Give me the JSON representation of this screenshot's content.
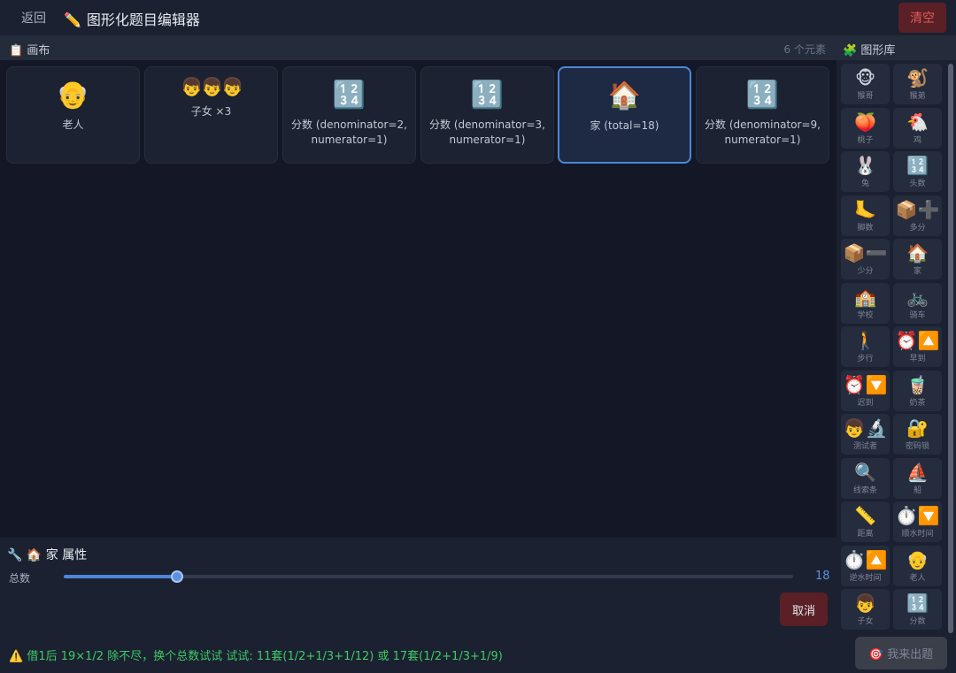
{
  "topbar": {
    "back_label": "返回",
    "title_icon": "✏️",
    "title": "图形化题目编辑器",
    "clear_label": "清空"
  },
  "canvas": {
    "icon": "📋",
    "title": "画布",
    "count_label": "6 个元素"
  },
  "cards": [
    {
      "icon": "👴",
      "label": "老人"
    },
    {
      "icon": "👦👦👦",
      "label": "子女 ×3"
    },
    {
      "icon": "🔢",
      "label": "分数 (denominator=2, numerator=1)"
    },
    {
      "icon": "🔢",
      "label": "分数 (denominator=3, numerator=1)"
    },
    {
      "icon": "🏠",
      "label": "家 (total=18)"
    },
    {
      "icon": "🔢",
      "label": "分数 (denominator=9, numerator=1)"
    }
  ],
  "properties": {
    "title_icon": "🔧",
    "element_icon": "🏠",
    "title": "家 属性",
    "field_label": "总数",
    "value": "18",
    "slider_fraction": 0.155,
    "cancel_label": "取消"
  },
  "status": {
    "text": "⚠️ 借1后 19×1/2 除不尽，换个总数试试 试试: 11套(1/2+1/3+1/12) 或 17套(1/2+1/3+1/9)"
  },
  "submit": {
    "label": "🎯 我来出题"
  },
  "library": {
    "icon": "🧩",
    "title": "图形库",
    "items": [
      {
        "icon": "🐵",
        "label": "猴哥"
      },
      {
        "icon": "🐒",
        "label": "猴弟"
      },
      {
        "icon": "🍑",
        "label": "桃子"
      },
      {
        "icon": "🐔",
        "label": "鸡"
      },
      {
        "icon": "🐰",
        "label": "兔"
      },
      {
        "icon": "🔢",
        "label": "头数"
      },
      {
        "icon": "🦶",
        "label": "脚数"
      },
      {
        "icon": "📦➕",
        "label": "多分"
      },
      {
        "icon": "📦➖",
        "label": "少分"
      },
      {
        "icon": "🏠",
        "label": "家"
      },
      {
        "icon": "🏫",
        "label": "学校"
      },
      {
        "icon": "🚲",
        "label": "骑车"
      },
      {
        "icon": "🚶",
        "label": "步行"
      },
      {
        "icon": "⏰🔼",
        "label": "早到"
      },
      {
        "icon": "⏰🔽",
        "label": "迟到"
      },
      {
        "icon": "🧋",
        "label": "奶茶"
      },
      {
        "icon": "👦🔬",
        "label": "测试者"
      },
      {
        "icon": "🔐",
        "label": "密码锁"
      },
      {
        "icon": "🔍",
        "label": "线索条"
      },
      {
        "icon": "⛵",
        "label": "船"
      },
      {
        "icon": "📏",
        "label": "距离"
      },
      {
        "icon": "⏱️🔽",
        "label": "顺水时间"
      },
      {
        "icon": "⏱️🔼",
        "label": "逆水时间"
      },
      {
        "icon": "👴",
        "label": "老人"
      },
      {
        "icon": "👦",
        "label": "子女"
      },
      {
        "icon": "🔢",
        "label": "分数"
      }
    ]
  }
}
